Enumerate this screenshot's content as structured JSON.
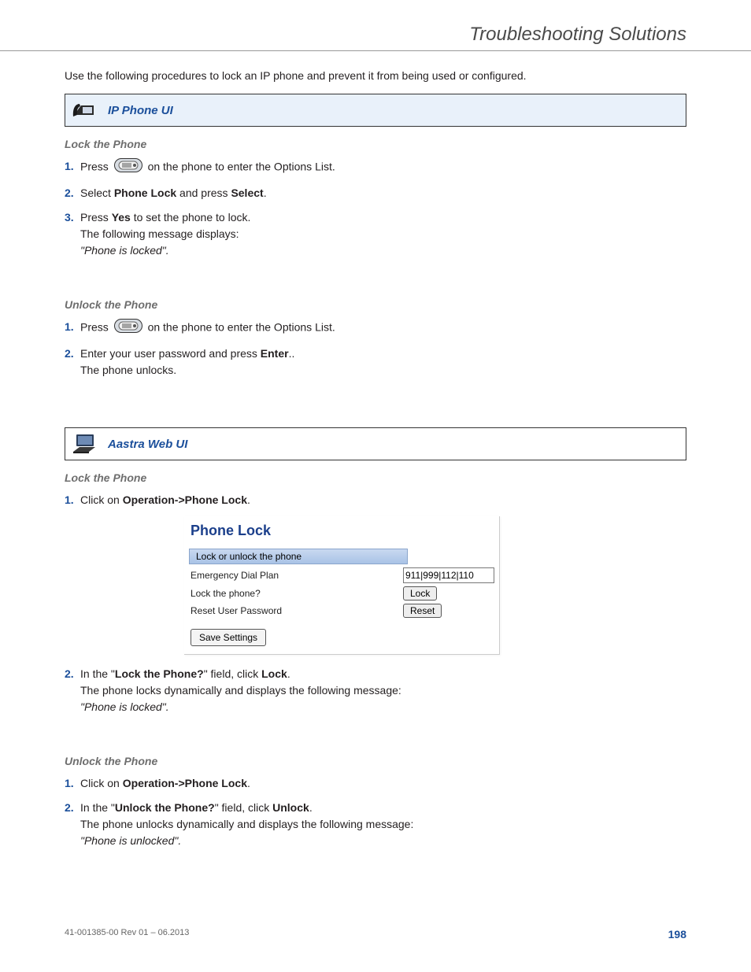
{
  "header": {
    "title": "Troubleshooting Solutions"
  },
  "intro": "Use the following procedures to lock an IP phone and prevent it from being used or configured.",
  "ip_phone_ui": {
    "label": "IP Phone UI",
    "lock_heading": "Lock the Phone",
    "lock_steps": {
      "s1a": "Press",
      "s1b": "on the phone to enter the Options List.",
      "s2a": "Select ",
      "s2b": "Phone Lock",
      "s2c": " and press ",
      "s2d": "Select",
      "s2e": ".",
      "s3a": "Press ",
      "s3b": "Yes",
      "s3c": " to set the phone to lock.",
      "s3d": "The following message displays:",
      "s3e": "\"Phone is locked\"."
    },
    "unlock_heading": "Unlock the Phone",
    "unlock_steps": {
      "s1a": "Press",
      "s1b": "on the phone to enter the Options List.",
      "s2a": "Enter your user password and press ",
      "s2b": "Enter",
      "s2c": "..",
      "s2d": "The phone unlocks."
    }
  },
  "web_ui": {
    "label": "Aastra Web UI",
    "lock_heading": "Lock the Phone",
    "lock_steps": {
      "s1a": "Click on ",
      "s1b": "Operation->Phone Lock",
      "s1c": ".",
      "s2a": "In the \"",
      "s2b": "Lock the Phone?",
      "s2c": "\" field, click ",
      "s2d": "Lock",
      "s2e": ".",
      "s2f": "The phone locks dynamically and displays the following message:",
      "s2g": "\"Phone is locked\"."
    },
    "unlock_heading": "Unlock the Phone",
    "unlock_steps": {
      "s1a": "Click on ",
      "s1b": "Operation->Phone Lock",
      "s1c": ".",
      "s2a": "In the \"",
      "s2b": "Unlock the Phone?",
      "s2c": "\" field, click ",
      "s2d": "Unlock",
      "s2e": ".",
      "s2f": "The phone unlocks dynamically and displays the following message:",
      "s2g": "\"Phone is unlocked\"."
    },
    "screenshot": {
      "title": "Phone Lock",
      "section": "Lock or unlock the phone",
      "row1_label": "Emergency Dial Plan",
      "row1_value": "911|999|112|110",
      "row2_label": "Lock the phone?",
      "row2_button": "Lock",
      "row3_label": "Reset User Password",
      "row3_button": "Reset",
      "save": "Save Settings"
    }
  },
  "footer": {
    "rev": "41-001385-00 Rev 01 – 06.2013",
    "page": "198"
  },
  "nums": {
    "n1": "1.",
    "n2": "2.",
    "n3": "3."
  }
}
